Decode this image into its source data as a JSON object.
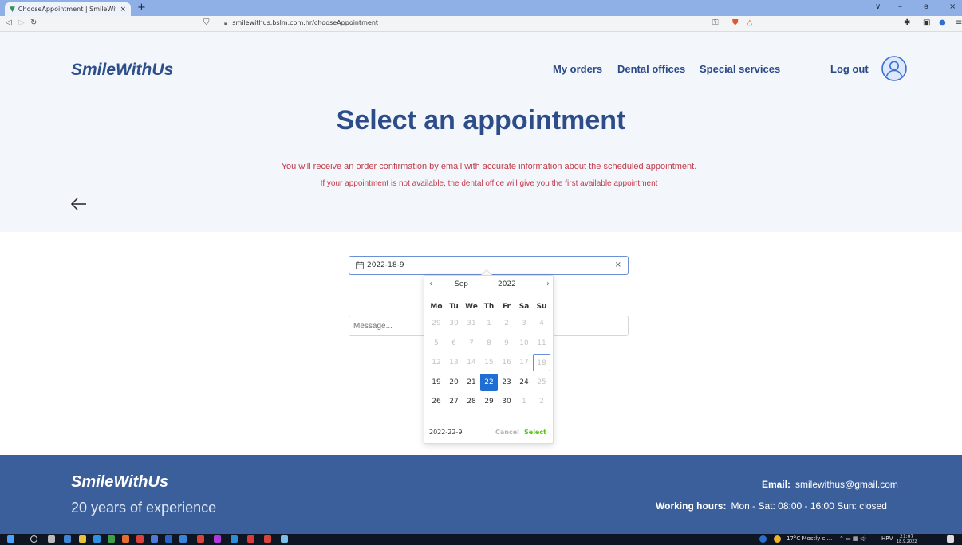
{
  "browser": {
    "tab_title": "ChooseAppointment | SmileWith…",
    "tab_close": "×",
    "new_tab": "+",
    "url": "smilewithus.bslm.com.hr/chooseAppointment",
    "window_controls": [
      "∨",
      "–",
      "ə",
      "×"
    ]
  },
  "header": {
    "logo": "SmileWithUs",
    "nav": [
      "My orders",
      "Dental offices",
      "Special services"
    ],
    "logout": "Log out"
  },
  "main": {
    "title": "Select an appointment",
    "info_line1": "You will receive an order confirmation by email with accurate information about the scheduled appointment.",
    "info_line2": "If your appointment is not available, the dental office will give you the first available appointment"
  },
  "form": {
    "date_value": "2022-18-9",
    "clear_label": "×",
    "message_placeholder": "Message..."
  },
  "calendar": {
    "month": "Sep",
    "year": "2022",
    "weekdays": [
      "Mo",
      "Tu",
      "We",
      "Th",
      "Fr",
      "Sa",
      "Su"
    ],
    "weeks": [
      [
        "29",
        "30",
        "31",
        "1",
        "2",
        "3",
        "4"
      ],
      [
        "5",
        "6",
        "7",
        "8",
        "9",
        "10",
        "11"
      ],
      [
        "12",
        "13",
        "14",
        "15",
        "16",
        "17",
        "18"
      ],
      [
        "19",
        "20",
        "21",
        "22",
        "23",
        "24",
        "25"
      ],
      [
        "26",
        "27",
        "28",
        "29",
        "30",
        "1",
        "2"
      ]
    ],
    "selected_date": "2022-22-9",
    "cancel": "Cancel",
    "select": "Select",
    "colors": {
      "selected": "#1f6ed4",
      "select_text": "#52c41a"
    }
  },
  "footer": {
    "brand": "SmileWithUs",
    "tagline": "20 years of experience",
    "email_label": "Email:",
    "email": "smilewithus@gmail.com",
    "hours_label": "Working hours:",
    "hours": "Mon - Sat: 08:00 - 16:00  Sun: closed"
  },
  "taskbar": {
    "weather": "17°C  Mostly cl…",
    "lang": "HRV",
    "time": "21:07",
    "date": "18.9.2022"
  },
  "colors": {
    "brand_blue": "#2c4d8a",
    "hero_bg": "#f3f6fb",
    "info_red": "#c23b4a",
    "footer_bg": "#3b5f9b"
  }
}
